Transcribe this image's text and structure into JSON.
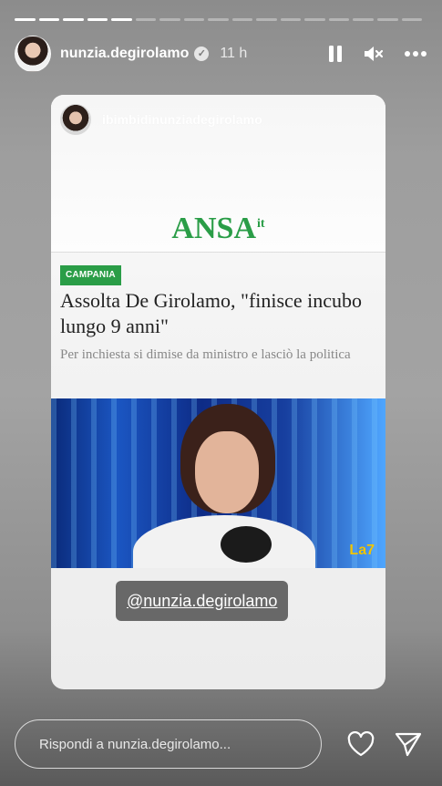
{
  "story": {
    "progress_total": 17,
    "progress_done": 5,
    "username": "nunzia.degirolamo",
    "verified_glyph": "✓",
    "time": "11 h",
    "icons": [
      "pause-icon",
      "mute-icon",
      "more-icon"
    ]
  },
  "card": {
    "account": "ibimbidinunziadegirolamo",
    "source_logo": "ANSA",
    "source_logo_suffix": "it",
    "section_tag": "CAMPANIA",
    "headline": "Assolta De Girolamo, \"finisce incubo lungo 9 anni\"",
    "subhead": "Per inchiesta si dimise da ministro e lasciò la politica",
    "channel_logo": "La7"
  },
  "mention": {
    "text": "@nunzia.degirolamo"
  },
  "footer": {
    "reply_placeholder": "Rispondi a nunzia.degirolamo...",
    "icons": [
      "heart-icon",
      "send-icon"
    ]
  },
  "colors": {
    "ansa_green": "#2a9d47",
    "text_dark": "#222222",
    "text_muted": "#888888"
  }
}
